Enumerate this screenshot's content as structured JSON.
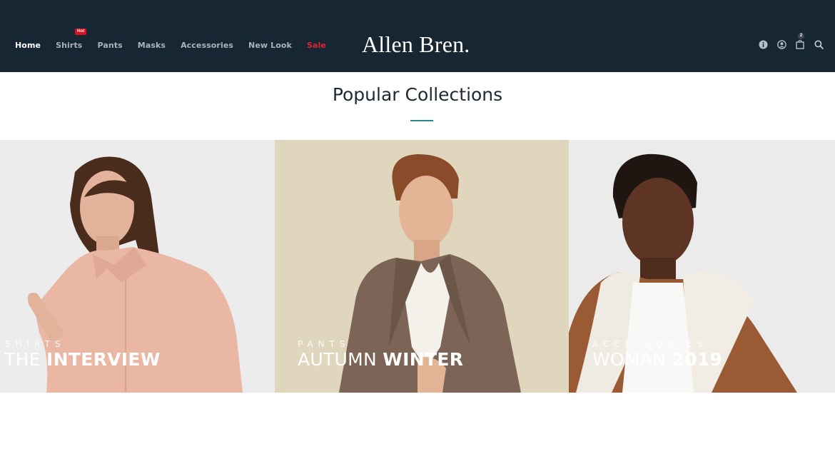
{
  "header": {
    "logo": "Allen Bren.",
    "nav": [
      {
        "label": "Home"
      },
      {
        "label": "Shirts",
        "badge": "Hot"
      },
      {
        "label": "Pants"
      },
      {
        "label": "Masks"
      },
      {
        "label": "Accessories"
      },
      {
        "label": "New Look"
      },
      {
        "label": "Sale"
      }
    ],
    "icons": [
      "info-icon",
      "account-icon",
      "cart-icon",
      "search-icon"
    ],
    "cart_count": "2"
  },
  "section": {
    "title": "Popular Collections"
  },
  "collections": [
    {
      "subtitle": "SHIRTS",
      "title_light": "THE ",
      "title_bold": "INTERVIEW"
    },
    {
      "subtitle": "PANTS",
      "title_light": "AUTUMN ",
      "title_bold": "WINTER"
    },
    {
      "subtitle": "ACCESSORIES",
      "title_light": "WOMAN ",
      "title_bold": "2019"
    }
  ],
  "colors": {
    "header_bg": "#172633",
    "accent": "#2a8b8b",
    "sale": "#e3232f",
    "hot_badge": "#d8101c"
  }
}
